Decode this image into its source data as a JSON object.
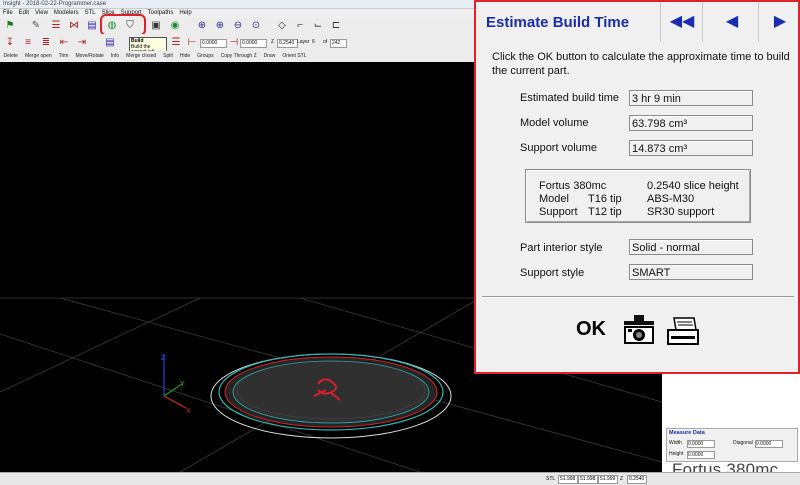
{
  "window": {
    "title": "Insight - 2018-02-22-Programmer.case"
  },
  "menu": [
    "File",
    "Edit",
    "View",
    "Modelers",
    "STL",
    "Slice",
    "Support",
    "Toolpaths",
    "Help"
  ],
  "toolbar2": {
    "field1": "0.0000",
    "field2": "0.0000",
    "z_label": "Z",
    "z_value": "0.2540",
    "layer_label": "Layer",
    "layer_value": "6",
    "of_label": "of",
    "of_value": "242"
  },
  "toolbar3": [
    "Delete",
    "Merge open",
    "Trim",
    "Move/Rotate",
    "Info",
    "Merge closed",
    "Split",
    "Hide",
    "Groups",
    "Copy Through Z",
    "Draw",
    "Orient STL"
  ],
  "tooltip": {
    "title": "Build",
    "text": "Build the current job"
  },
  "dialog": {
    "title": "Estimate Build Time",
    "instruction": "Click the OK button to calculate the approximate time to build the current part.",
    "rows": [
      {
        "label": "Estimated build time",
        "value": "3 hr 9 min"
      },
      {
        "label": "Model volume",
        "value": "63.798 cm³"
      },
      {
        "label": "Support volume",
        "value": "14.873 cm³"
      }
    ],
    "info": {
      "machine": "Fortus 380mc",
      "slice": "0.2540 slice height",
      "model_label": "Model",
      "model_tip": "T16 tip",
      "model_material": "ABS-M30",
      "support_label": "Support",
      "support_tip": "T12 tip",
      "support_material": "SR30 support"
    },
    "rows2": [
      {
        "label": "Part interior style",
        "value": "Solid - normal"
      },
      {
        "label": "Support style",
        "value": "SMART"
      }
    ],
    "ok_label": "OK"
  },
  "measure": {
    "title": "Measure Data",
    "width_label": "Width",
    "width_value": "0.0000",
    "height_label": "Height",
    "height_value": "0.0000",
    "diagonal_label": "Diagonal",
    "diagonal_value": "0.0000"
  },
  "brand": {
    "prefix": "Fortus",
    "model": "380mc"
  },
  "statusbar": {
    "mode": "STL",
    "x": "51.998",
    "y": "51.998",
    "x2": "51.999",
    "z_label": "Z",
    "z": "0.2540"
  },
  "colors": {
    "accent_red": "#e0202a",
    "title_blue": "#1a2db0",
    "model_red": "#d8202a",
    "support_teal": "#28b4b4"
  }
}
